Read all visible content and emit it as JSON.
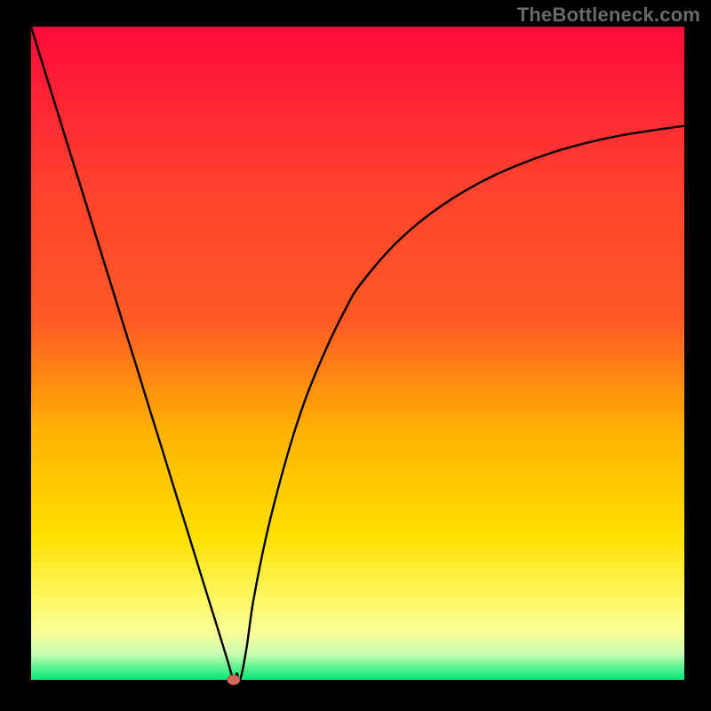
{
  "watermark": "TheBottleneck.com",
  "colors": {
    "background": "#000000",
    "curve": "#000000",
    "watermark": "#6a6a6a",
    "gradient_top": "#ff0a3a",
    "gradient_mid1": "#ff5a25",
    "gradient_mid2": "#ffb300",
    "gradient_mid3": "#ffe000",
    "gradient_mid4": "#fff968",
    "gradient_band": "#f8ff9a",
    "gradient_bottom": "#00e676",
    "marker_fill": "#d66a5a",
    "marker_stroke": "#b24a3a"
  },
  "plot": {
    "inner_x": 35,
    "inner_y": 30,
    "inner_w": 735,
    "inner_h": 735
  },
  "chart_data": {
    "type": "line",
    "title": "",
    "xlabel": "",
    "ylabel": "",
    "xlim": [
      0,
      100
    ],
    "ylim": [
      0,
      100
    ],
    "x": [
      0,
      2,
      4,
      6,
      8,
      10,
      12,
      14,
      16,
      18,
      20,
      22,
      24,
      26,
      28,
      30,
      31,
      31.5,
      32,
      33,
      34,
      36,
      38,
      40,
      42,
      44,
      46,
      48,
      50,
      55,
      60,
      65,
      70,
      75,
      80,
      85,
      90,
      95,
      100
    ],
    "values": [
      100,
      93.5,
      87.1,
      80.6,
      74.2,
      67.7,
      61.3,
      54.8,
      48.4,
      41.9,
      35.5,
      29.0,
      22.6,
      16.1,
      9.7,
      3.2,
      0,
      1.0,
      0,
      5,
      12,
      22,
      30,
      37,
      43,
      48,
      52.5,
      56.5,
      60,
      66,
      70.5,
      74,
      76.8,
      79,
      80.8,
      82.2,
      83.3,
      84.1,
      84.8
    ],
    "marker": {
      "x": 31,
      "y": 0
    },
    "notes": "Axes are unlabeled; values estimated from pixel positions on a 0–100 normalized scale. Dip minimum (≈0) occurs at x≈31. Curve rises asymptotically toward ≈85 on the right."
  }
}
